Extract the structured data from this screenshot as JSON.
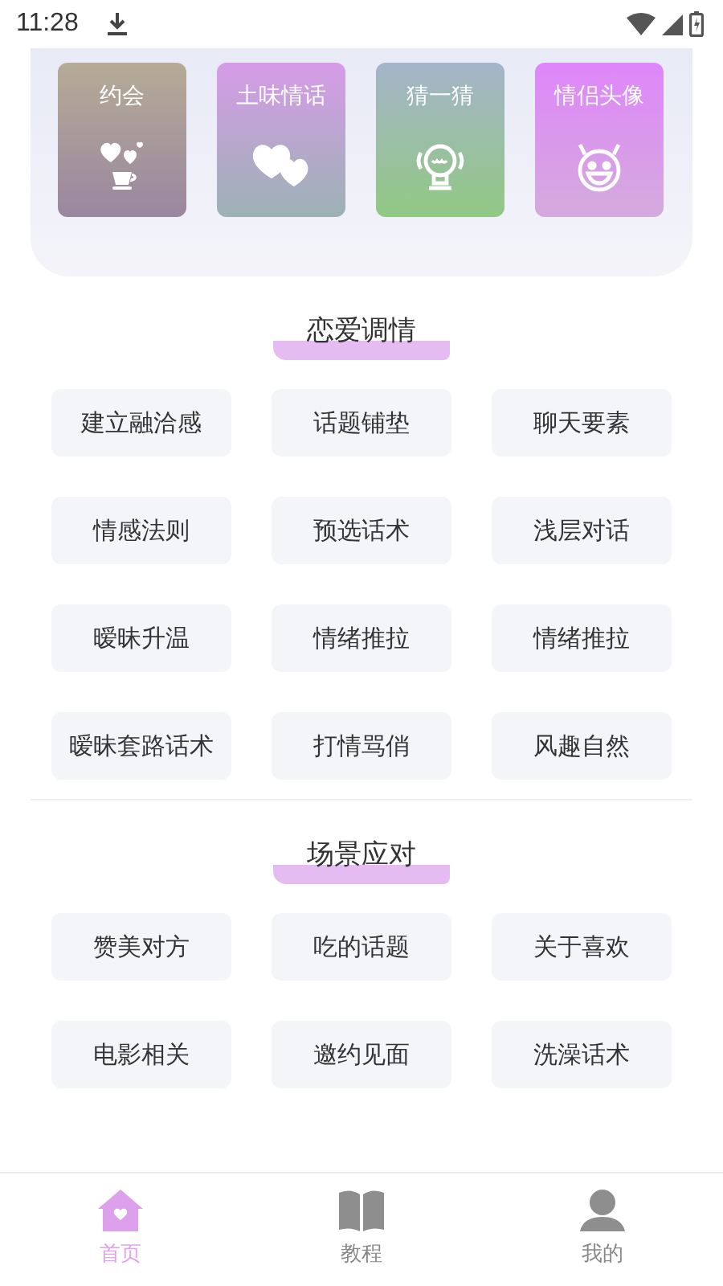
{
  "status_bar": {
    "time": "11:28"
  },
  "feature_tiles": [
    {
      "label": "约会",
      "kind": "date"
    },
    {
      "label": "土味情话",
      "kind": "talk"
    },
    {
      "label": "猜一猜",
      "kind": "guess"
    },
    {
      "label": "情侣头像",
      "kind": "avatar"
    }
  ],
  "sections": [
    {
      "title": "恋爱调情",
      "items": [
        "建立融洽感",
        "话题铺垫",
        "聊天要素",
        "情感法则",
        "预选话术",
        "浅层对话",
        "暧昧升温",
        "情绪推拉",
        "情绪推拉",
        "暧昧套路话术",
        "打情骂俏",
        "风趣自然"
      ]
    },
    {
      "title": "场景应对",
      "items": [
        "赞美对方",
        "吃的话题",
        "关于喜欢",
        "电影相关",
        "邀约见面",
        "洗澡话术"
      ]
    }
  ],
  "tab_bar": [
    {
      "label": "首页",
      "kind": "home",
      "selected": true
    },
    {
      "label": "教程",
      "kind": "book",
      "selected": false
    },
    {
      "label": "我的",
      "kind": "person",
      "selected": false
    }
  ]
}
